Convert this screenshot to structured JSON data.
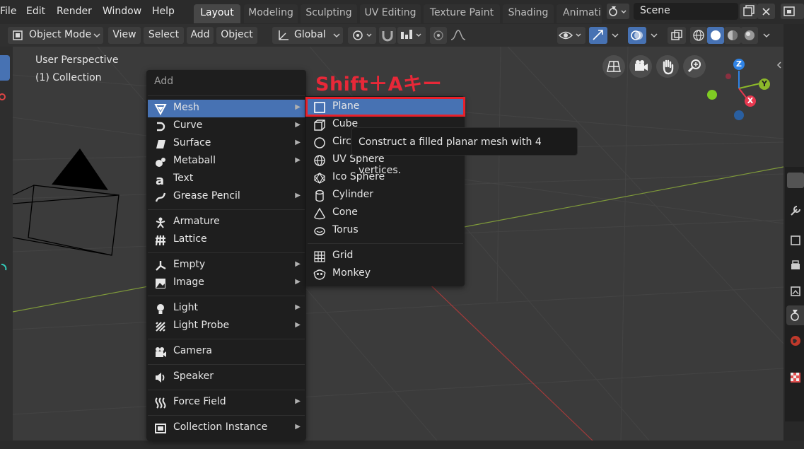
{
  "menubar": {
    "items": [
      "File",
      "Edit",
      "Render",
      "Window",
      "Help"
    ]
  },
  "workspaces": [
    "Layout",
    "Modeling",
    "Sculpting",
    "UV Editing",
    "Texture Paint",
    "Shading",
    "Animati"
  ],
  "scene": {
    "label": "Scene"
  },
  "header": {
    "mode": "Object Mode",
    "menus": [
      "View",
      "Select",
      "Add",
      "Object"
    ],
    "transform_orientation": "Global"
  },
  "viewport": {
    "perspective": "User Perspective",
    "collection": "(1) Collection"
  },
  "annotation": "Shift＋Aキー",
  "add_menu": {
    "title": "Add",
    "items": [
      {
        "label": "Mesh",
        "icon": "mesh-icon",
        "submenu": true
      },
      {
        "label": "Curve",
        "icon": "curve-icon",
        "submenu": true
      },
      {
        "label": "Surface",
        "icon": "surface-icon",
        "submenu": true
      },
      {
        "label": "Metaball",
        "icon": "metaball-icon",
        "submenu": true
      },
      {
        "label": "Text",
        "icon": "text-icon",
        "submenu": false
      },
      {
        "label": "Grease Pencil",
        "icon": "grease-pencil-icon",
        "submenu": true
      },
      {
        "label": "Armature",
        "icon": "armature-icon",
        "submenu": false
      },
      {
        "label": "Lattice",
        "icon": "lattice-icon",
        "submenu": false
      },
      {
        "label": "Empty",
        "icon": "empty-icon",
        "submenu": true
      },
      {
        "label": "Image",
        "icon": "image-icon",
        "submenu": true
      },
      {
        "label": "Light",
        "icon": "light-icon",
        "submenu": true
      },
      {
        "label": "Light Probe",
        "icon": "light-probe-icon",
        "submenu": true
      },
      {
        "label": "Camera",
        "icon": "camera-icon",
        "submenu": false
      },
      {
        "label": "Speaker",
        "icon": "speaker-icon",
        "submenu": false
      },
      {
        "label": "Force Field",
        "icon": "force-field-icon",
        "submenu": true
      },
      {
        "label": "Collection Instance",
        "icon": "collection-instance-icon",
        "submenu": true
      }
    ]
  },
  "mesh_menu": {
    "items": [
      {
        "label": "Plane",
        "icon": "plane-icon"
      },
      {
        "label": "Cube",
        "icon": "cube-icon"
      },
      {
        "label": "Circ",
        "icon": "circle-icon"
      },
      {
        "label": "UV Sphere",
        "icon": "uv-sphere-icon"
      },
      {
        "label": "Ico Sphere",
        "icon": "ico-sphere-icon"
      },
      {
        "label": "Cylinder",
        "icon": "cylinder-icon"
      },
      {
        "label": "Cone",
        "icon": "cone-icon"
      },
      {
        "label": "Torus",
        "icon": "torus-icon"
      },
      {
        "label": "Grid",
        "icon": "grid-icon"
      },
      {
        "label": "Monkey",
        "icon": "monkey-icon"
      }
    ]
  },
  "tooltip": "Construct a filled planar mesh with 4 vertices.",
  "gizmo": {
    "z": "Z",
    "y": "Y",
    "x": "X"
  },
  "colors": {
    "highlight": "#4772b3",
    "annotation_red": "#e8202a",
    "axis_x": "#e8384f",
    "axis_y": "#8cb82a",
    "axis_z": "#2f83e6"
  }
}
